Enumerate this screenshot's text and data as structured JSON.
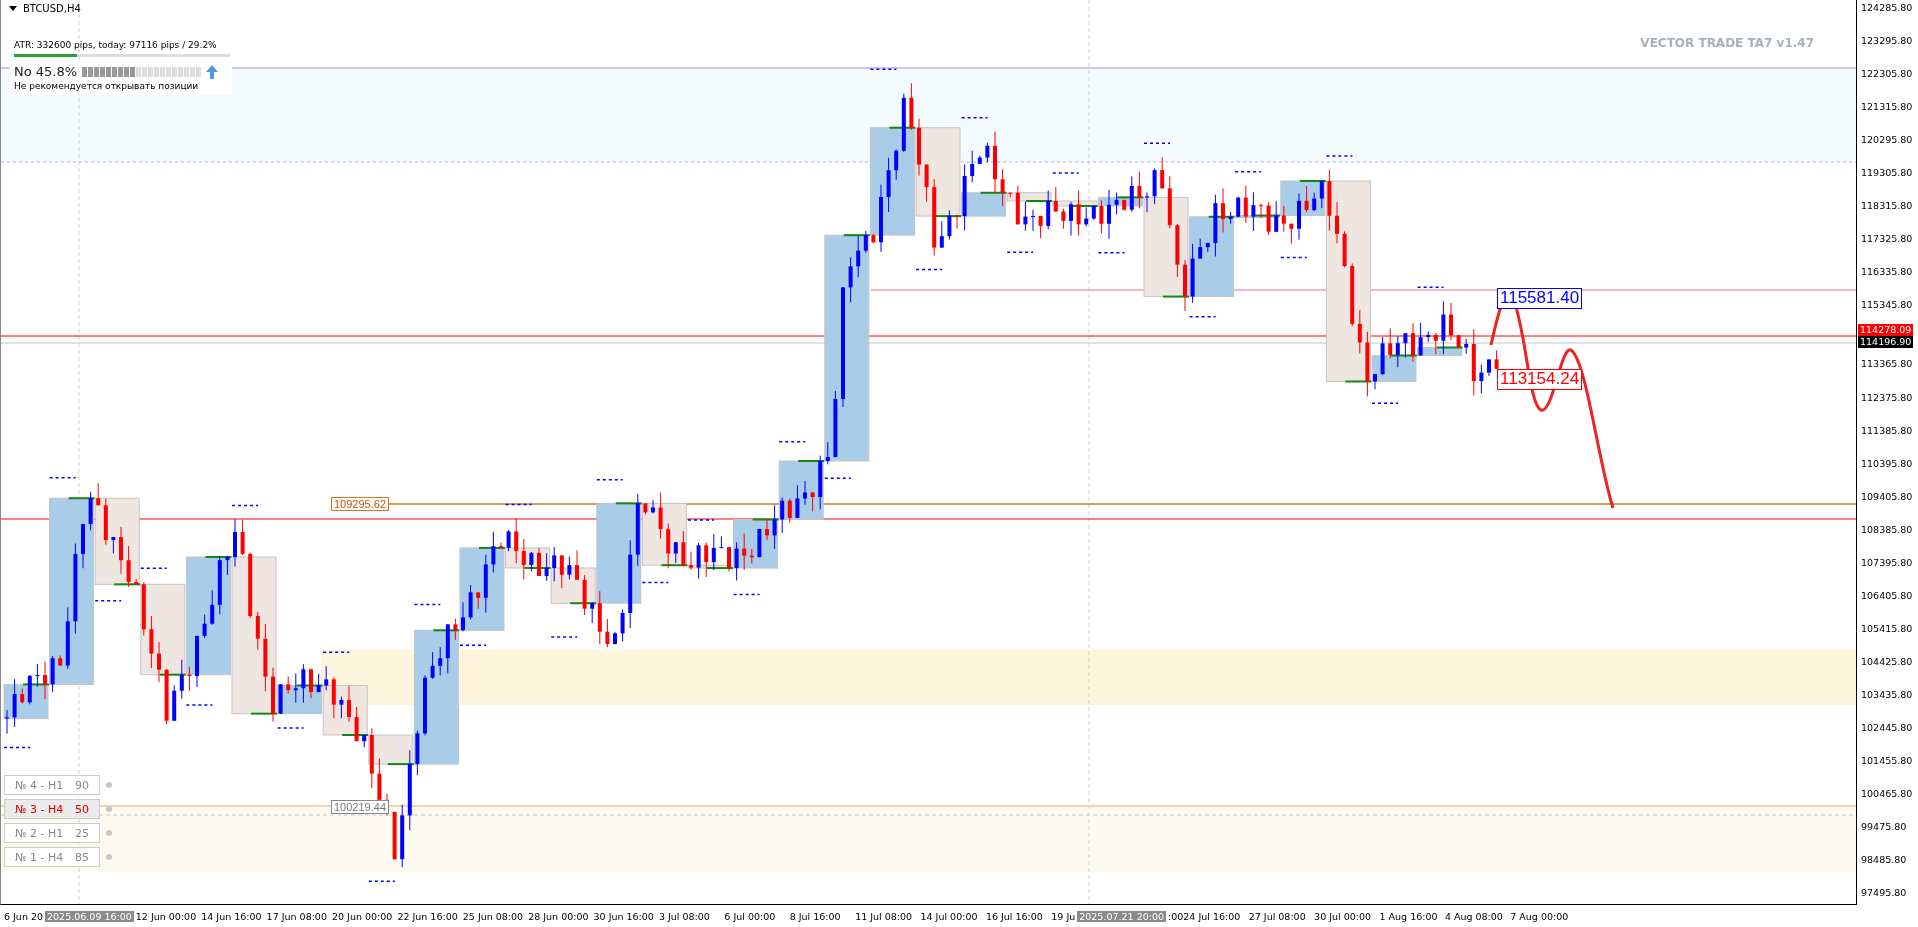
{
  "chart": {
    "symbol": "BTCUSD,H4",
    "atr": {
      "text": "ATR: 332600 pips, today: 97116 pips / 29.2%",
      "level": 0.29
    },
    "signal": {
      "headline": "No 45.8%",
      "level": 0.45,
      "advice": "Не рекомендуется открывать позиции"
    },
    "indicator_label": "VECTOR TRADE TA7 v1.47",
    "price_labels": [
      {
        "text": "109295.62",
        "kind": "level"
      },
      {
        "text": "100219.44",
        "kind": "mark"
      },
      {
        "text": "115581.40",
        "kind": "target_up"
      },
      {
        "text": "113154.24",
        "kind": "target_down"
      }
    ],
    "levels": [
      {
        "label": "№ 4 - H1",
        "value": "90",
        "selected": false
      },
      {
        "label": "№ 3 - H4",
        "value": "50",
        "selected": true
      },
      {
        "label": "№ 2 - H1",
        "value": "25",
        "selected": false
      },
      {
        "label": "№ 1 - H4",
        "value": "85",
        "selected": false
      }
    ]
  },
  "price_axis": [
    {
      "text": "124285.80",
      "kind": "tick"
    },
    {
      "text": "123295.80",
      "kind": "tick"
    },
    {
      "text": "122305.80",
      "kind": "tick"
    },
    {
      "text": "121315.80",
      "kind": "tick"
    },
    {
      "text": "120295.80",
      "kind": "tick"
    },
    {
      "text": "119305.80",
      "kind": "tick"
    },
    {
      "text": "118315.80",
      "kind": "tick"
    },
    {
      "text": "117325.80",
      "kind": "tick"
    },
    {
      "text": "116335.80",
      "kind": "tick"
    },
    {
      "text": "115345.80",
      "kind": "tick"
    },
    {
      "text": "114278.09",
      "kind": "ask"
    },
    {
      "text": "114196.90",
      "kind": "bid"
    },
    {
      "text": "113365.80",
      "kind": "tick"
    },
    {
      "text": "112375.80",
      "kind": "tick"
    },
    {
      "text": "111385.80",
      "kind": "tick"
    },
    {
      "text": "110395.80",
      "kind": "tick"
    },
    {
      "text": "109405.80",
      "kind": "tick"
    },
    {
      "text": "108385.80",
      "kind": "tick"
    },
    {
      "text": "107395.80",
      "kind": "tick"
    },
    {
      "text": "106405.80",
      "kind": "tick"
    },
    {
      "text": "105415.80",
      "kind": "tick"
    },
    {
      "text": "104425.80",
      "kind": "tick"
    },
    {
      "text": "103435.80",
      "kind": "tick"
    },
    {
      "text": "102445.80",
      "kind": "tick"
    },
    {
      "text": "101455.80",
      "kind": "tick"
    },
    {
      "text": "100465.80",
      "kind": "tick"
    },
    {
      "text": "99475.80",
      "kind": "tick"
    },
    {
      "text": "98485.80",
      "kind": "tick"
    },
    {
      "text": "97495.80",
      "kind": "tick"
    }
  ],
  "time_axis": [
    {
      "text": "6 Jun 20",
      "kind": "cut"
    },
    {
      "text": "2025.06.09 16:00",
      "kind": "cursor"
    },
    {
      "text": "12 Jun 00:00",
      "kind": "tick"
    },
    {
      "text": "14 Jun 16:00",
      "kind": "tick"
    },
    {
      "text": "17 Jun 08:00",
      "kind": "tick"
    },
    {
      "text": "20 Jun 00:00",
      "kind": "tick"
    },
    {
      "text": "22 Jun 16:00",
      "kind": "tick"
    },
    {
      "text": "25 Jun 08:00",
      "kind": "tick"
    },
    {
      "text": "28 Jun 00:00",
      "kind": "tick"
    },
    {
      "text": "30 Jun 16:00",
      "kind": "tick"
    },
    {
      "text": "3 Jul 08:00",
      "kind": "tick"
    },
    {
      "text": "6 Jul 00:00",
      "kind": "tick"
    },
    {
      "text": "8 Jul 16:00",
      "kind": "tick"
    },
    {
      "text": "11 Jul 08:00",
      "kind": "tick"
    },
    {
      "text": "14 Jul 00:00",
      "kind": "tick"
    },
    {
      "text": "16 Jul 16:00",
      "kind": "tick"
    },
    {
      "text": "19 Ju",
      "kind": "cut"
    },
    {
      "text": "2025.07.21 20:00",
      "kind": "cursor"
    },
    {
      "text": ":00",
      "kind": "cut"
    },
    {
      "text": "24 Jul 16:00",
      "kind": "tick"
    },
    {
      "text": "27 Jul 08:00",
      "kind": "tick"
    },
    {
      "text": "30 Jul 00:00",
      "kind": "tick"
    },
    {
      "text": "1 Aug 16:00",
      "kind": "tick"
    },
    {
      "text": "4 Aug 08:00",
      "kind": "tick"
    },
    {
      "text": "7 Aug 00:00",
      "kind": "tick"
    }
  ]
}
